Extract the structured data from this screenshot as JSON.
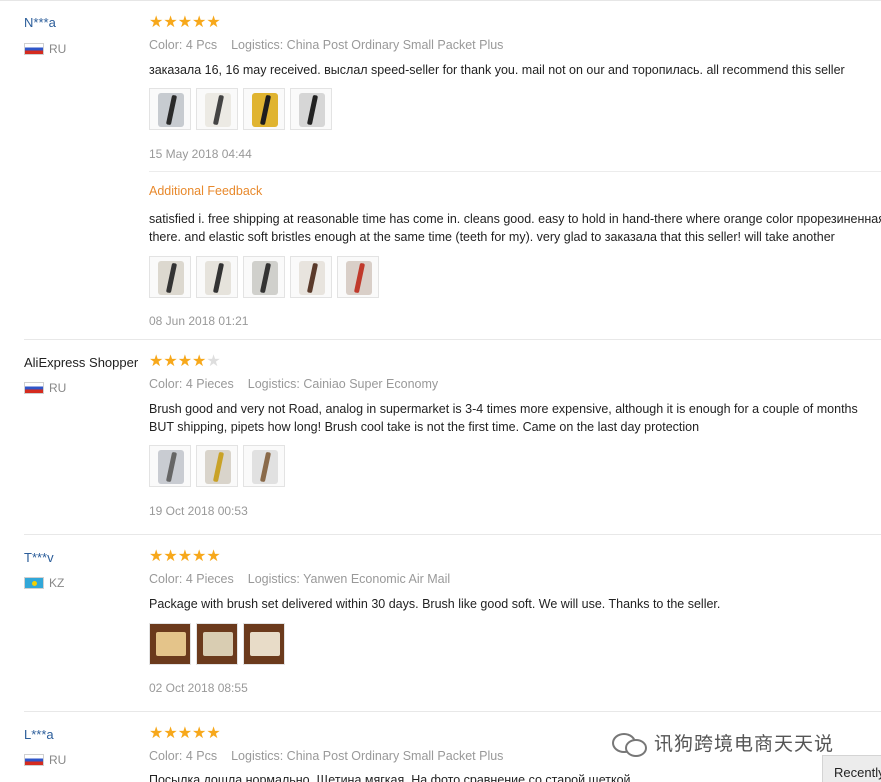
{
  "reviews": [
    {
      "user": "N***a",
      "country": "RU",
      "stars": 5,
      "color": "Color: 4 Pcs",
      "logistics": "Logistics: China Post Ordinary Small Packet Plus",
      "text": "заказала 16, 16 may received. выслал speed-seller for thank you. mail not on our and торопилась. all recommend this seller",
      "date": "15 May 2018 04:44",
      "additional_label": "Additional Feedback",
      "additional_text_1": "satisfied i. free shipping at reasonable time has come in. cleans good. easy to hold in hand-there where orange color прорезиненная",
      "additional_text_2": "there. and elastic soft bristles enough at the same time (teeth for my). very glad to заказала that this seller! will take another",
      "additional_date": "08 Jun 2018 01:21"
    },
    {
      "user": "AliExpress Shopper",
      "country": "RU",
      "stars": 4,
      "color": "Color: 4 Pieces",
      "logistics": "Logistics: Cainiao Super Economy",
      "text_1": "Brush good and very not Road, analog in supermarket is 3-4 times more expensive, although it is enough for a couple of months",
      "text_2": "BUT shipping, pipets how long! Brush cool take is not the first time. Came on the last day protection",
      "date": "19 Oct 2018 00:53"
    },
    {
      "user": "T***v",
      "country": "KZ",
      "stars": 5,
      "color": "Color: 4 Pieces",
      "logistics": "Logistics: Yanwen Economic Air Mail",
      "text": "Package with brush set delivered within 30 days. Brush like good soft. We will use. Thanks to the seller.",
      "date": "02 Oct 2018 08:55"
    },
    {
      "user": "L***a",
      "country": "RU",
      "stars": 5,
      "color": "Color: 4 Pcs",
      "logistics": "Logistics: China Post Ordinary Small Packet Plus",
      "text": "Посылка дошла нормально. Щетина мягкая. На фото сравнение со старой щеткой"
    }
  ],
  "watermark": "讯狗跨境电商天天说",
  "recent_tab": "Recently"
}
